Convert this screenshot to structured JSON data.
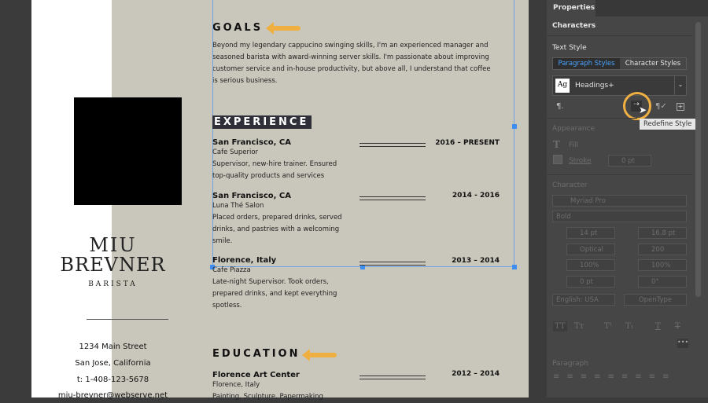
{
  "resume": {
    "name_line1": "MIU",
    "name_line2": "BREVNER",
    "role": "BARISTA",
    "contact": [
      "1234 Main Street",
      "San Jose, California",
      "t: 1-408-123-5678",
      "miu-brevner@webserve.net"
    ],
    "goals": {
      "heading": "GOALS",
      "text": [
        "Beyond my legendary cappucino swinging skills, I'm an experienced manager and",
        "seasoned barista with award-winning server skills. I'm passionate about improving",
        "customer service and in-house productivity, but above all, I understand that coffee",
        "is serious business."
      ]
    },
    "experience": {
      "heading": "EXPERIENCE",
      "jobs": [
        {
          "place": "San Francisco, CA",
          "company": "Cafe Superior",
          "dates": "2016 – PRESENT",
          "desc": [
            "Supervisor, new-hire trainer. Ensured",
            "top-quality products and services"
          ]
        },
        {
          "place": "San Francisco, CA",
          "company": "Luna Thé Salon",
          "dates": "2014 - 2016",
          "desc": [
            "Placed orders, prepared drinks, served",
            "drinks, and pastries with a welcoming",
            "smile."
          ]
        },
        {
          "place": "Florence, Italy",
          "company": "Cafe Piazza",
          "dates": "2013 – 2014",
          "desc": [
            "Late-night Supervisor. Took orders,",
            "prepared drinks, and kept everything",
            "spotless."
          ]
        }
      ]
    },
    "education": {
      "heading": "EDUCATION",
      "place": "Florence Art Center",
      "location": "Florence, Italy",
      "dates": "2012 – 2014",
      "desc": "Painting, Sculpture, Papermaking"
    }
  },
  "panel": {
    "tab": "Properties",
    "section": "Characters",
    "text_style": "Text Style",
    "tabs": [
      "Paragraph Styles",
      "Character Styles"
    ],
    "style_preview": "Ag",
    "style_name": "Headings+",
    "tooltip": "Redefine Style",
    "appearance": "Appearance",
    "fill": "Fill",
    "stroke": "Stroke",
    "stroke_value": "0 pt",
    "character": "Character",
    "font": "Myriad Pro",
    "font_style": "Bold",
    "size": "14 pt",
    "leading": "16.8 pt",
    "kerning": "Optical",
    "tracking": "200",
    "vscale": "100%",
    "hscale": "100%",
    "baseline": "0 pt",
    "rotation": "0°",
    "language": "English: USA",
    "opentype": "OpenType",
    "paragraph": "Paragraph",
    "accent": "#3d8ef0",
    "highlight": "#f0b041"
  }
}
